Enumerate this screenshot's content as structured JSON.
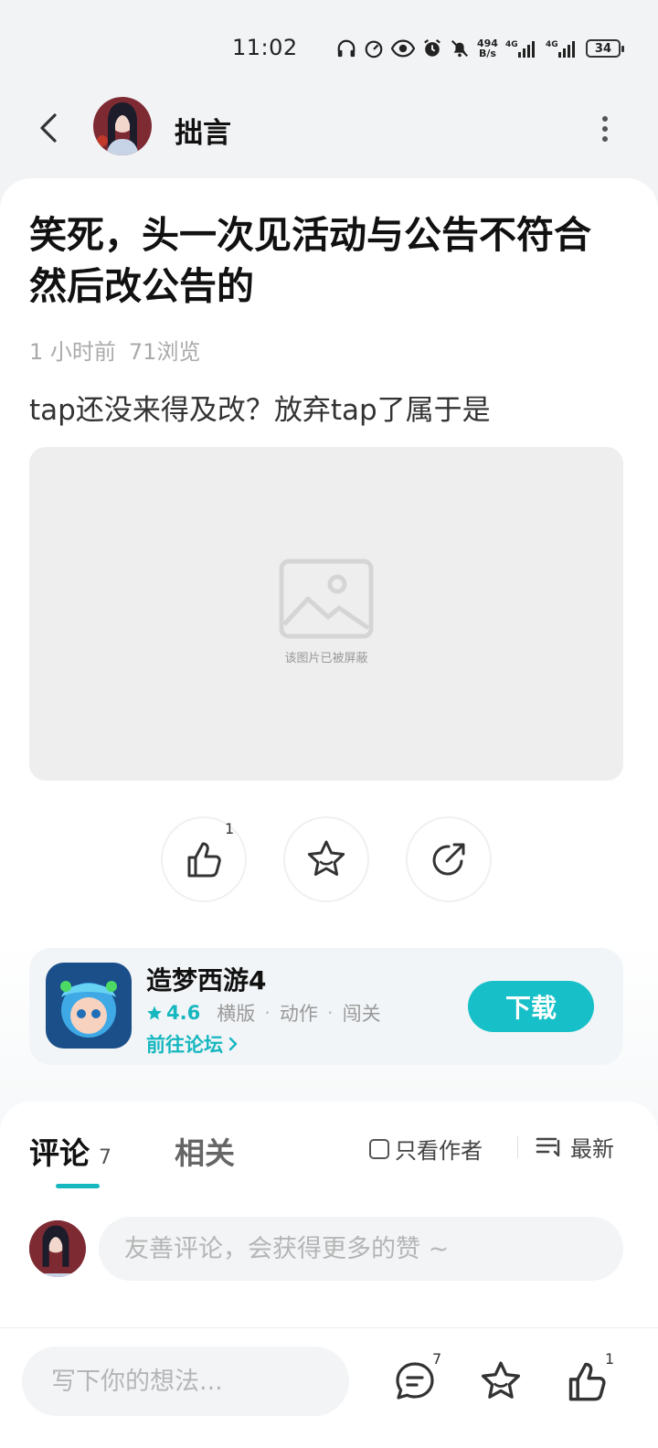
{
  "status_bar": {
    "time": "11:02",
    "net_speed_value": "494",
    "net_speed_unit": "B/s",
    "signal1_label": "4G",
    "signal2_label": "4G",
    "battery": "34"
  },
  "header": {
    "author": "拙言"
  },
  "post": {
    "title": "笑死，头一次见活动与公告不符合然后改公告的",
    "time_ago": "1 小时前",
    "views": "71浏览",
    "body": "tap还没来得及改？放弃tap了属于是",
    "blocked_image_text": "该图片已被屏蔽",
    "like_count": "1"
  },
  "game": {
    "name": "造梦西游4",
    "rating": "4.6",
    "tags": [
      "横版",
      "动作",
      "闯关"
    ],
    "forum_link": "前往论坛",
    "download_label": "下载"
  },
  "comments": {
    "tab_label": "评论",
    "count": "7",
    "related_label": "相关",
    "author_only_label": "只看作者",
    "sort_label": "最新",
    "input_placeholder": "友善评论，会获得更多的赞 ~"
  },
  "bottom_bar": {
    "reply_placeholder": "写下你的想法...",
    "comment_count": "7",
    "like_count": "1"
  },
  "colors": {
    "accent": "#17c0c8",
    "background": "#f2f3f5"
  },
  "icons": [
    "back-icon",
    "more-icon",
    "like-icon",
    "star-icon",
    "share-icon",
    "image-placeholder-icon",
    "chevron-right-icon",
    "sort-icon",
    "comment-icon"
  ]
}
